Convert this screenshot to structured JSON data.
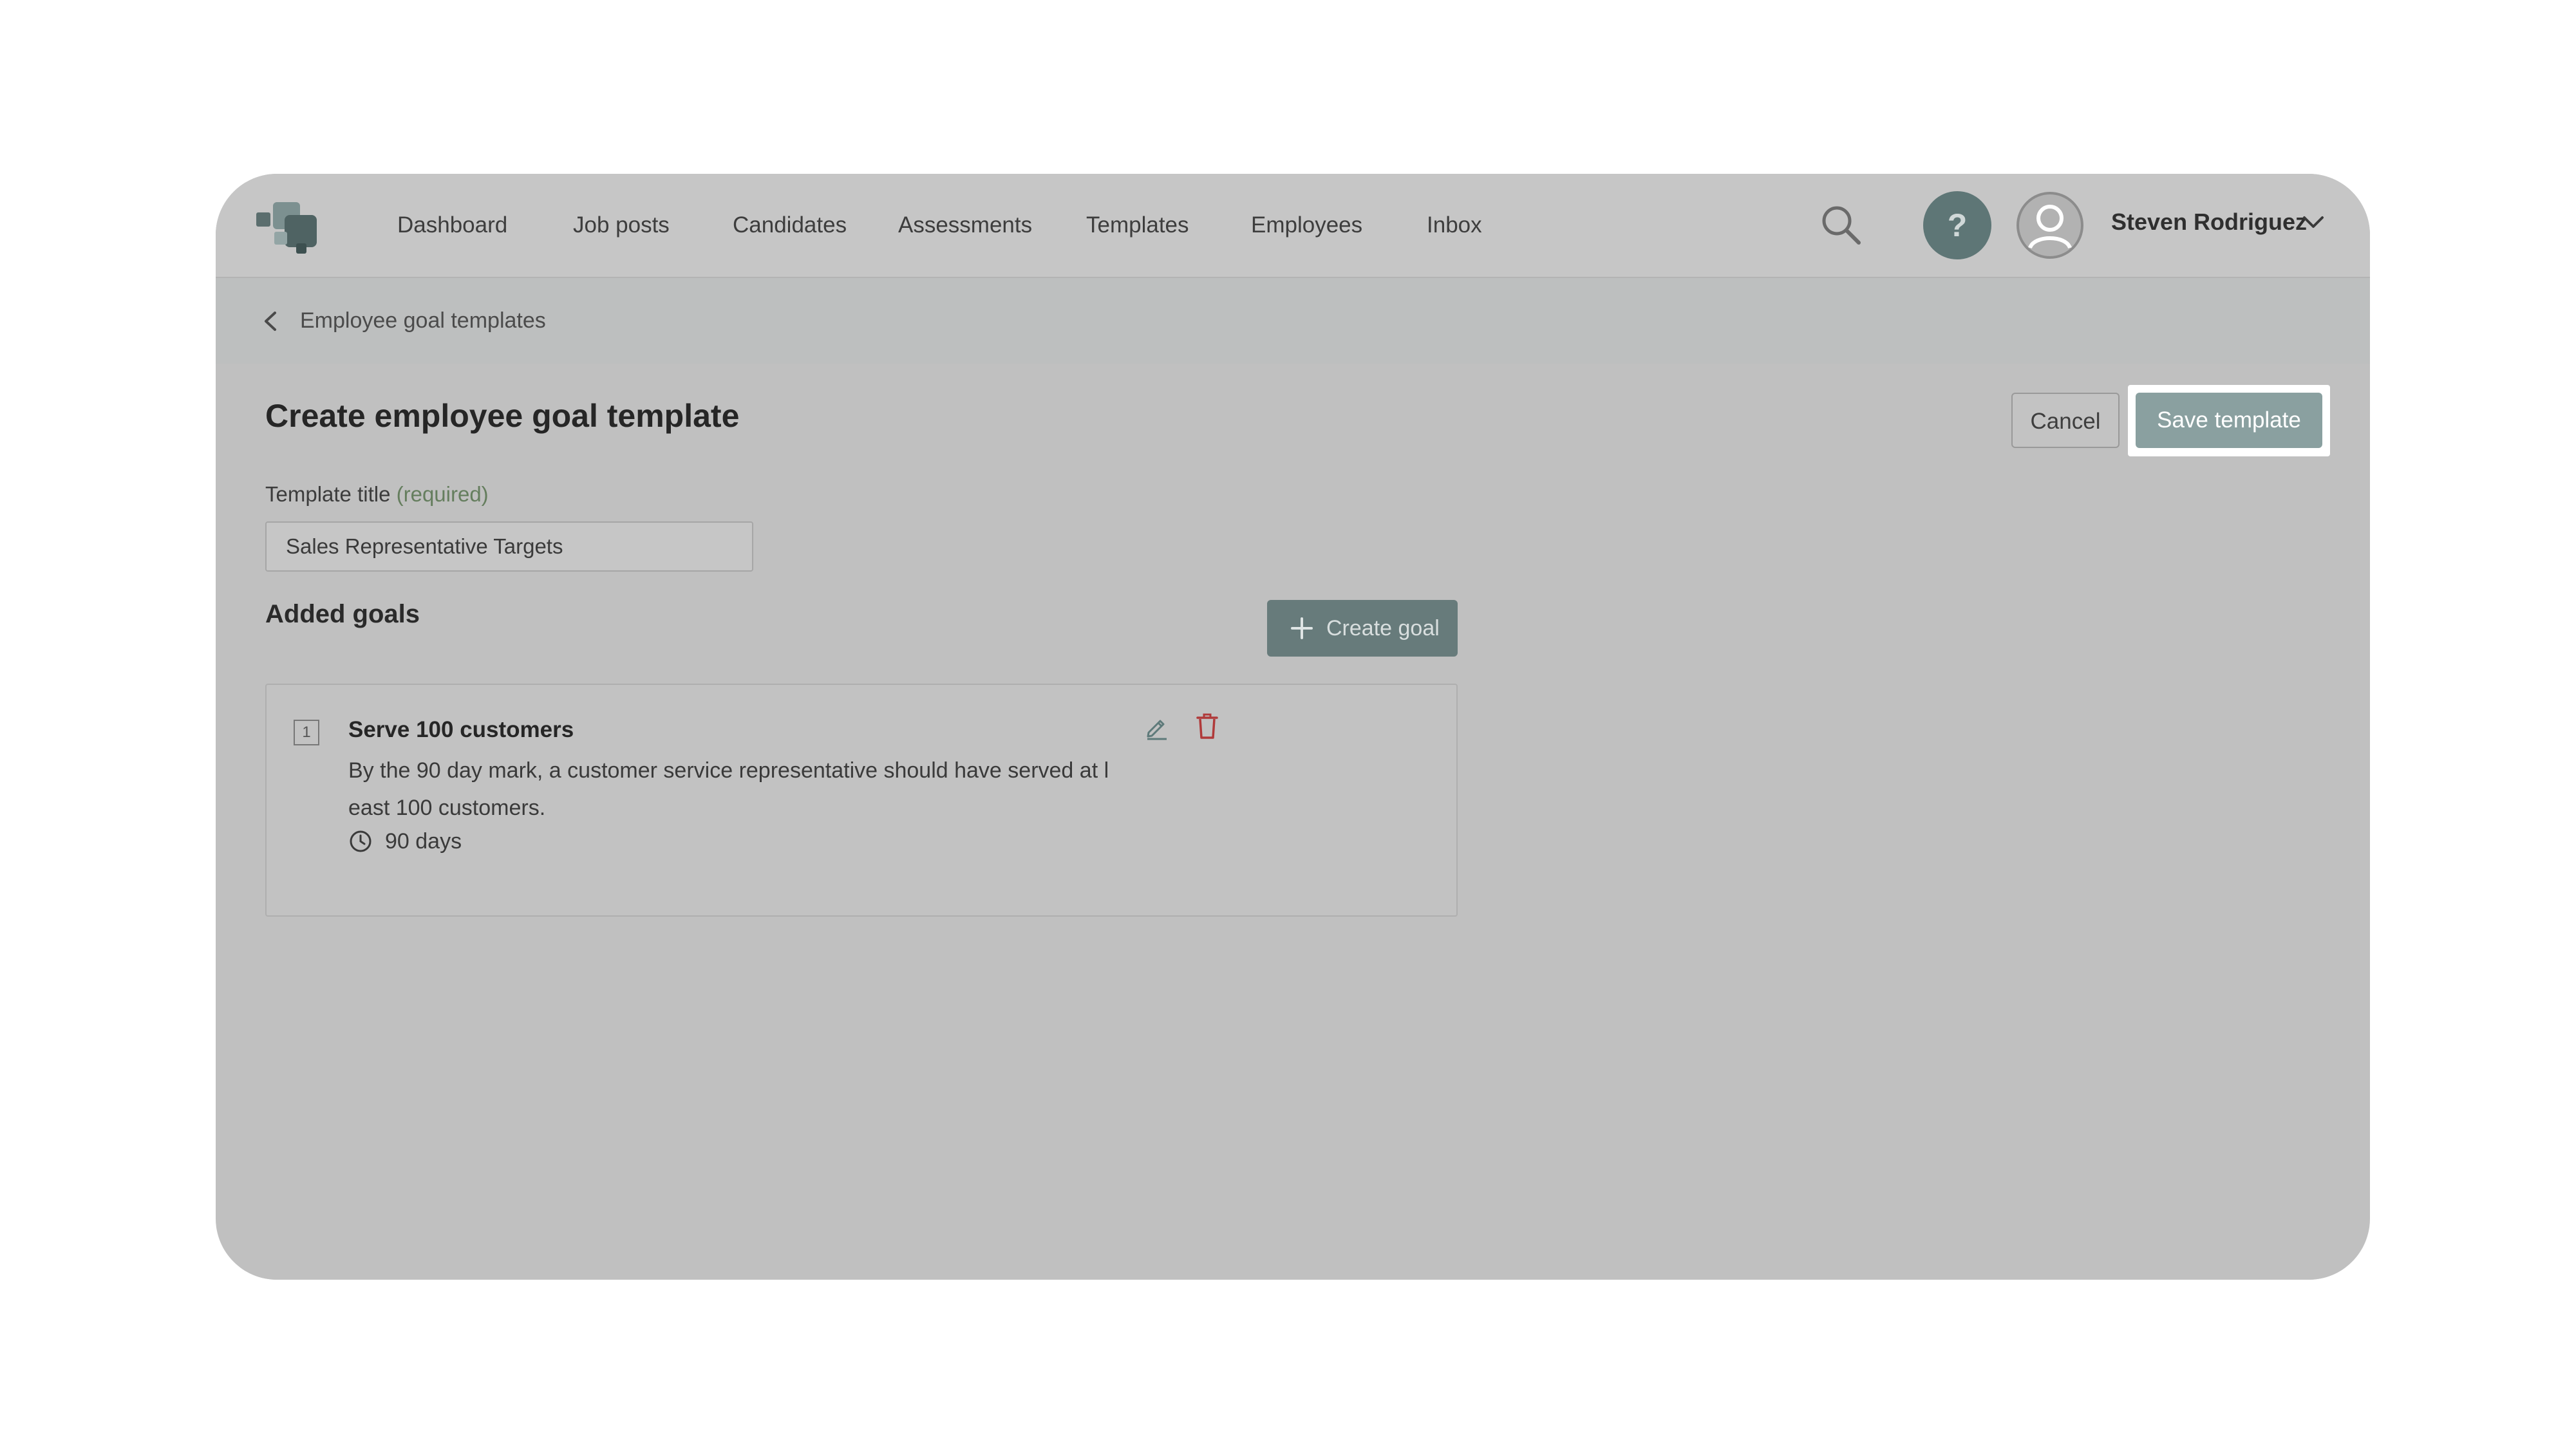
{
  "nav": {
    "items": [
      {
        "label": "Dashboard"
      },
      {
        "label": "Job posts"
      },
      {
        "label": "Candidates"
      },
      {
        "label": "Assessments"
      },
      {
        "label": "Templates"
      },
      {
        "label": "Employees"
      },
      {
        "label": "Inbox"
      }
    ],
    "help_label": "?",
    "user_name": "Steven Rodriguez"
  },
  "breadcrumb": {
    "label": "Employee goal templates"
  },
  "page": {
    "title": "Create employee goal template",
    "cancel_label": "Cancel",
    "save_label": "Save template"
  },
  "form": {
    "title_label": "Template title",
    "required_label": "(required)",
    "title_value": "Sales Representative Targets"
  },
  "goals": {
    "section_title": "Added goals",
    "create_label": "Create goal",
    "items": [
      {
        "number": "1",
        "title": "Serve 100 customers",
        "description": "By the 90 day mark, a customer service representative should have served at least 100 customers.",
        "duration": "90 days"
      }
    ]
  },
  "colors": {
    "accent": "#677b7b",
    "save_button": "#8aa0a0",
    "help_button": "#5e7676",
    "required_text": "#657e5e",
    "delete_icon": "#b03a3a",
    "edit_icon": "#5e7a7a"
  },
  "icons": {
    "logo": "app-logo",
    "search": "search-icon",
    "help": "help-icon",
    "avatar": "user-avatar-icon",
    "dropdown": "chevron-down-icon",
    "back": "chevron-left-icon",
    "plus": "plus-icon",
    "edit": "pencil-icon",
    "delete": "trash-icon",
    "clock": "clock-icon"
  }
}
